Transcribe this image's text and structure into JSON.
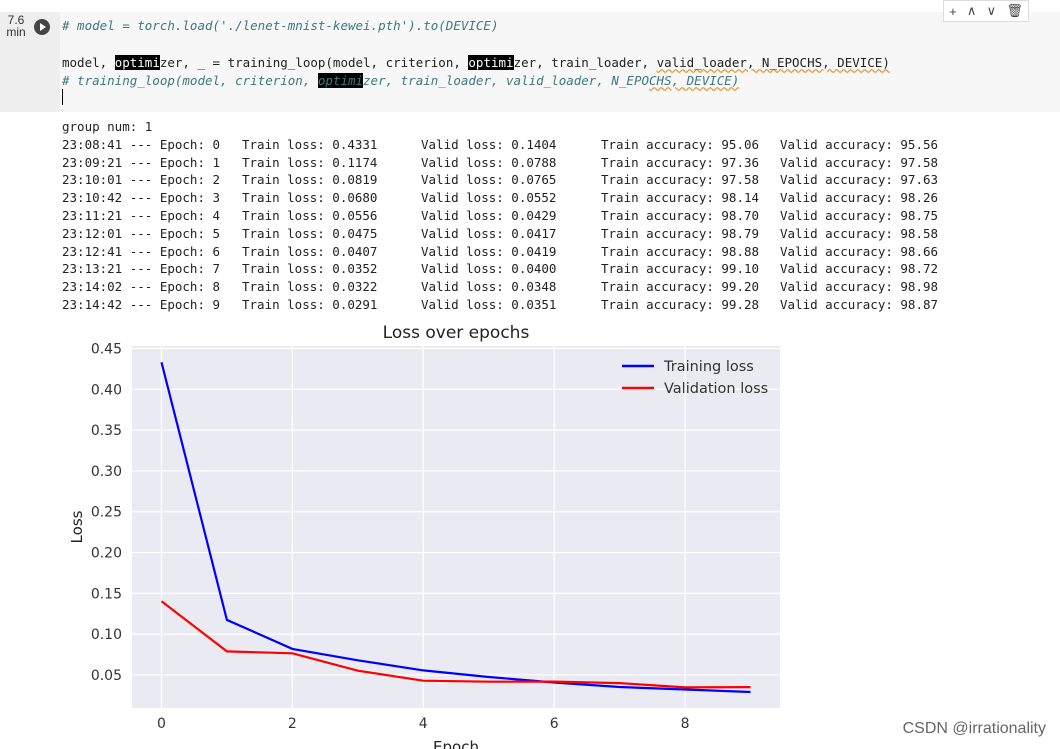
{
  "cell": {
    "exec_time": "7.6\nmin",
    "toolbar": {
      "add_icon": "+",
      "up_icon": "∧",
      "down_icon": "∨",
      "delete_icon": "🗑"
    },
    "code_line1": "# model = torch.load('./lenet-mnist-kewei.pth').to(DEVICE)",
    "code_line2_parts": [
      "model, ",
      "optimi",
      "zer, _ = training_loop(model, criterion, ",
      "optimi",
      "zer, train_loader, ",
      "valid_loader, N_EPOCHS, DEVICE)"
    ],
    "code_line3_parts": [
      "# training_loop(model, criterion, ",
      "optimi",
      "zer, train_loader, valid_loader, N_EPO",
      "CHS, DEVICE)"
    ]
  },
  "output": {
    "header": "group num: 1",
    "rows": [
      {
        "time": "23:08:41",
        "epoch": "0",
        "train_loss": "0.4331",
        "valid_loss": "0.1404",
        "train_acc": "95.06",
        "valid_acc": "95.56"
      },
      {
        "time": "23:09:21",
        "epoch": "1",
        "train_loss": "0.1174",
        "valid_loss": "0.0788",
        "train_acc": "97.36",
        "valid_acc": "97.58"
      },
      {
        "time": "23:10:01",
        "epoch": "2",
        "train_loss": "0.0819",
        "valid_loss": "0.0765",
        "train_acc": "97.58",
        "valid_acc": "97.63"
      },
      {
        "time": "23:10:42",
        "epoch": "3",
        "train_loss": "0.0680",
        "valid_loss": "0.0552",
        "train_acc": "98.14",
        "valid_acc": "98.26"
      },
      {
        "time": "23:11:21",
        "epoch": "4",
        "train_loss": "0.0556",
        "valid_loss": "0.0429",
        "train_acc": "98.70",
        "valid_acc": "98.75"
      },
      {
        "time": "23:12:01",
        "epoch": "5",
        "train_loss": "0.0475",
        "valid_loss": "0.0417",
        "train_acc": "98.79",
        "valid_acc": "98.58"
      },
      {
        "time": "23:12:41",
        "epoch": "6",
        "train_loss": "0.0407",
        "valid_loss": "0.0419",
        "train_acc": "98.88",
        "valid_acc": "98.66"
      },
      {
        "time": "23:13:21",
        "epoch": "7",
        "train_loss": "0.0352",
        "valid_loss": "0.0400",
        "train_acc": "99.10",
        "valid_acc": "98.72"
      },
      {
        "time": "23:14:02",
        "epoch": "8",
        "train_loss": "0.0322",
        "valid_loss": "0.0348",
        "train_acc": "99.20",
        "valid_acc": "98.98"
      },
      {
        "time": "23:14:42",
        "epoch": "9",
        "train_loss": "0.0291",
        "valid_loss": "0.0351",
        "train_acc": "99.28",
        "valid_acc": "98.87"
      }
    ],
    "labels": {
      "sep": "--- Epoch: ",
      "train_loss": "Train loss: ",
      "valid_loss": "Valid loss: ",
      "train_acc": "Train accuracy: ",
      "valid_acc": "Valid accuracy: "
    }
  },
  "chart_data": {
    "type": "line",
    "title": "Loss over epochs",
    "xlabel": "Epoch",
    "ylabel": "Loss",
    "x": [
      0,
      1,
      2,
      3,
      4,
      5,
      6,
      7,
      8,
      9
    ],
    "series": [
      {
        "name": "Training loss",
        "color": "#0000ff",
        "values": [
          0.4331,
          0.1174,
          0.0819,
          0.068,
          0.0556,
          0.0475,
          0.0407,
          0.0352,
          0.0322,
          0.0291
        ]
      },
      {
        "name": "Validation loss",
        "color": "#ff0000",
        "values": [
          0.1404,
          0.0788,
          0.0765,
          0.0552,
          0.0429,
          0.0417,
          0.0419,
          0.04,
          0.0348,
          0.0351
        ]
      }
    ],
    "xticks": [
      "0",
      "2",
      "4",
      "6",
      "8"
    ],
    "yticks": [
      "0.05",
      "0.10",
      "0.15",
      "0.20",
      "0.25",
      "0.30",
      "0.35",
      "0.40",
      "0.45"
    ],
    "xlim": [
      -0.45,
      9.45
    ],
    "ylim": [
      0.0095,
      0.4531
    ],
    "grid": true,
    "legend": "top-right",
    "background": "#eaeaf2"
  },
  "watermark": "CSDN @irrationality"
}
